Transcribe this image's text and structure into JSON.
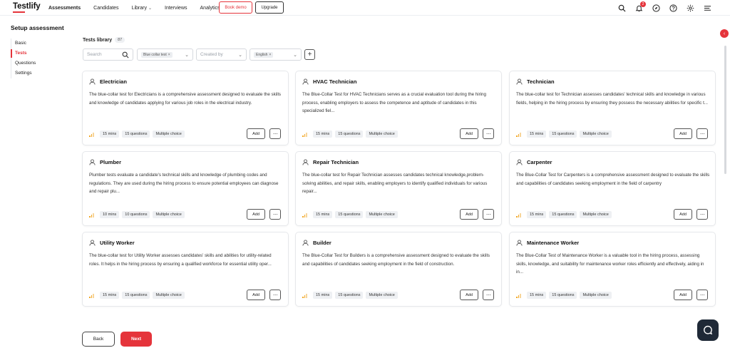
{
  "app": {
    "logo": "Testlify",
    "colors": {
      "brand": "#e5343b",
      "text": "#1f2937",
      "chip": "#eceef1",
      "level": "#f2a623"
    }
  },
  "nav": {
    "items": [
      {
        "label": "Assessments",
        "active": true
      },
      {
        "label": "Candidates"
      },
      {
        "label": "Library",
        "dropdown": true
      },
      {
        "label": "Interviews"
      },
      {
        "label": "Analytics"
      }
    ],
    "book_demo": "Book demo",
    "upgrade": "Upgrade",
    "notification_count": "2",
    "icons": [
      "search-icon",
      "bell-icon",
      "compass-icon",
      "help-icon",
      "gear-icon",
      "menu-icon"
    ]
  },
  "page": {
    "title": "Setup assessment",
    "steps": [
      {
        "label": "Basic"
      },
      {
        "label": "Tests",
        "active": true
      },
      {
        "label": "Questions"
      },
      {
        "label": "Settings"
      }
    ]
  },
  "library": {
    "title": "Tests library",
    "count": "87",
    "search_placeholder": "Search",
    "filter_type_chip": "Blue collar test",
    "filter_created_by": "Created by",
    "filter_language_chip": "English"
  },
  "cards": [
    {
      "title": "Electrician",
      "desc": "The blue-collar test for Electricians is a comprehensive assessment designed to evaluate the skills and knowledge of candidates applying for various job roles in the electrical industry.",
      "time": "15 mins",
      "questions": "15 questions",
      "type": "Multiple choice",
      "add": "Add"
    },
    {
      "title": "HVAC Technician",
      "desc": "The Blue-Collar Test for HVAC Technicians serves as a crucial evaluation tool during the hiring process, enabling employers to assess the competence and aptitude of candidates in this specialized fiel...",
      "time": "15 mins",
      "questions": "15 questions",
      "type": "Multiple choice",
      "add": "Add"
    },
    {
      "title": "Technician",
      "desc": "The blue-collar test for Technician assesses candidates' technical skills and knowledge in various fields, helping in the hiring process by ensuring they possess the necessary abilities for specific t...",
      "time": "15 mins",
      "questions": "15 questions",
      "type": "Multiple choice",
      "add": "Add"
    },
    {
      "title": "Plumber",
      "desc": "Plumber tests evaluate a candidate's technical skills and knowledge of plumbing codes and regulations. They are used during the hiring process to ensure potential employees can diagnose and repair plu...",
      "time": "10 mins",
      "questions": "10 questions",
      "type": "Multiple choice",
      "add": "Add"
    },
    {
      "title": "Repair Technician",
      "desc": "The blue-collar test for Repair Technician assesses candidates technical knowledge,problem-solving abilities, and repair skills, enabling employers to identify qualified individuals for various repair...",
      "time": "15 mins",
      "questions": "15 questions",
      "type": "Multiple choice",
      "add": "Add"
    },
    {
      "title": "Carpenter",
      "desc": "The Blue-Collar Test for Carpenters is a comprehensive assessment designed to evaluate the skills and capabilities of candidates seeking employment in the field of carpentry",
      "time": "15 mins",
      "questions": "15 questions",
      "type": "Multiple choice",
      "add": "Add"
    },
    {
      "title": "Utility Worker",
      "desc": "The blue-collar test for Utility Worker assesses candidates' skills and abilities for utility-related roles. It helps in the hiring process by ensuring a qualified workforce for essential utility oper...",
      "time": "15 mins",
      "questions": "15 questions",
      "type": "Multiple choice",
      "add": "Add"
    },
    {
      "title": "Builder",
      "desc": "The Blue-Collar Test for Builders is a comprehensive assessment designed to evaluate the skills and capabilities of candidates seeking employment in the field of construction.",
      "time": "15 mins",
      "questions": "15 questions",
      "type": "Multiple choice",
      "add": "Add"
    },
    {
      "title": "Maintenance Worker",
      "desc": "The Blue-Collar Test of Maintenance Worker is a valuable tool in the hiring process, assessing skills, knowledge, and suitability for maintenance worker roles efficiently and effectively, aiding in in...",
      "time": "15 mins",
      "questions": "15 questions",
      "type": "Multiple choice",
      "add": "Add"
    }
  ],
  "footer": {
    "back": "Back",
    "next": "Next"
  }
}
